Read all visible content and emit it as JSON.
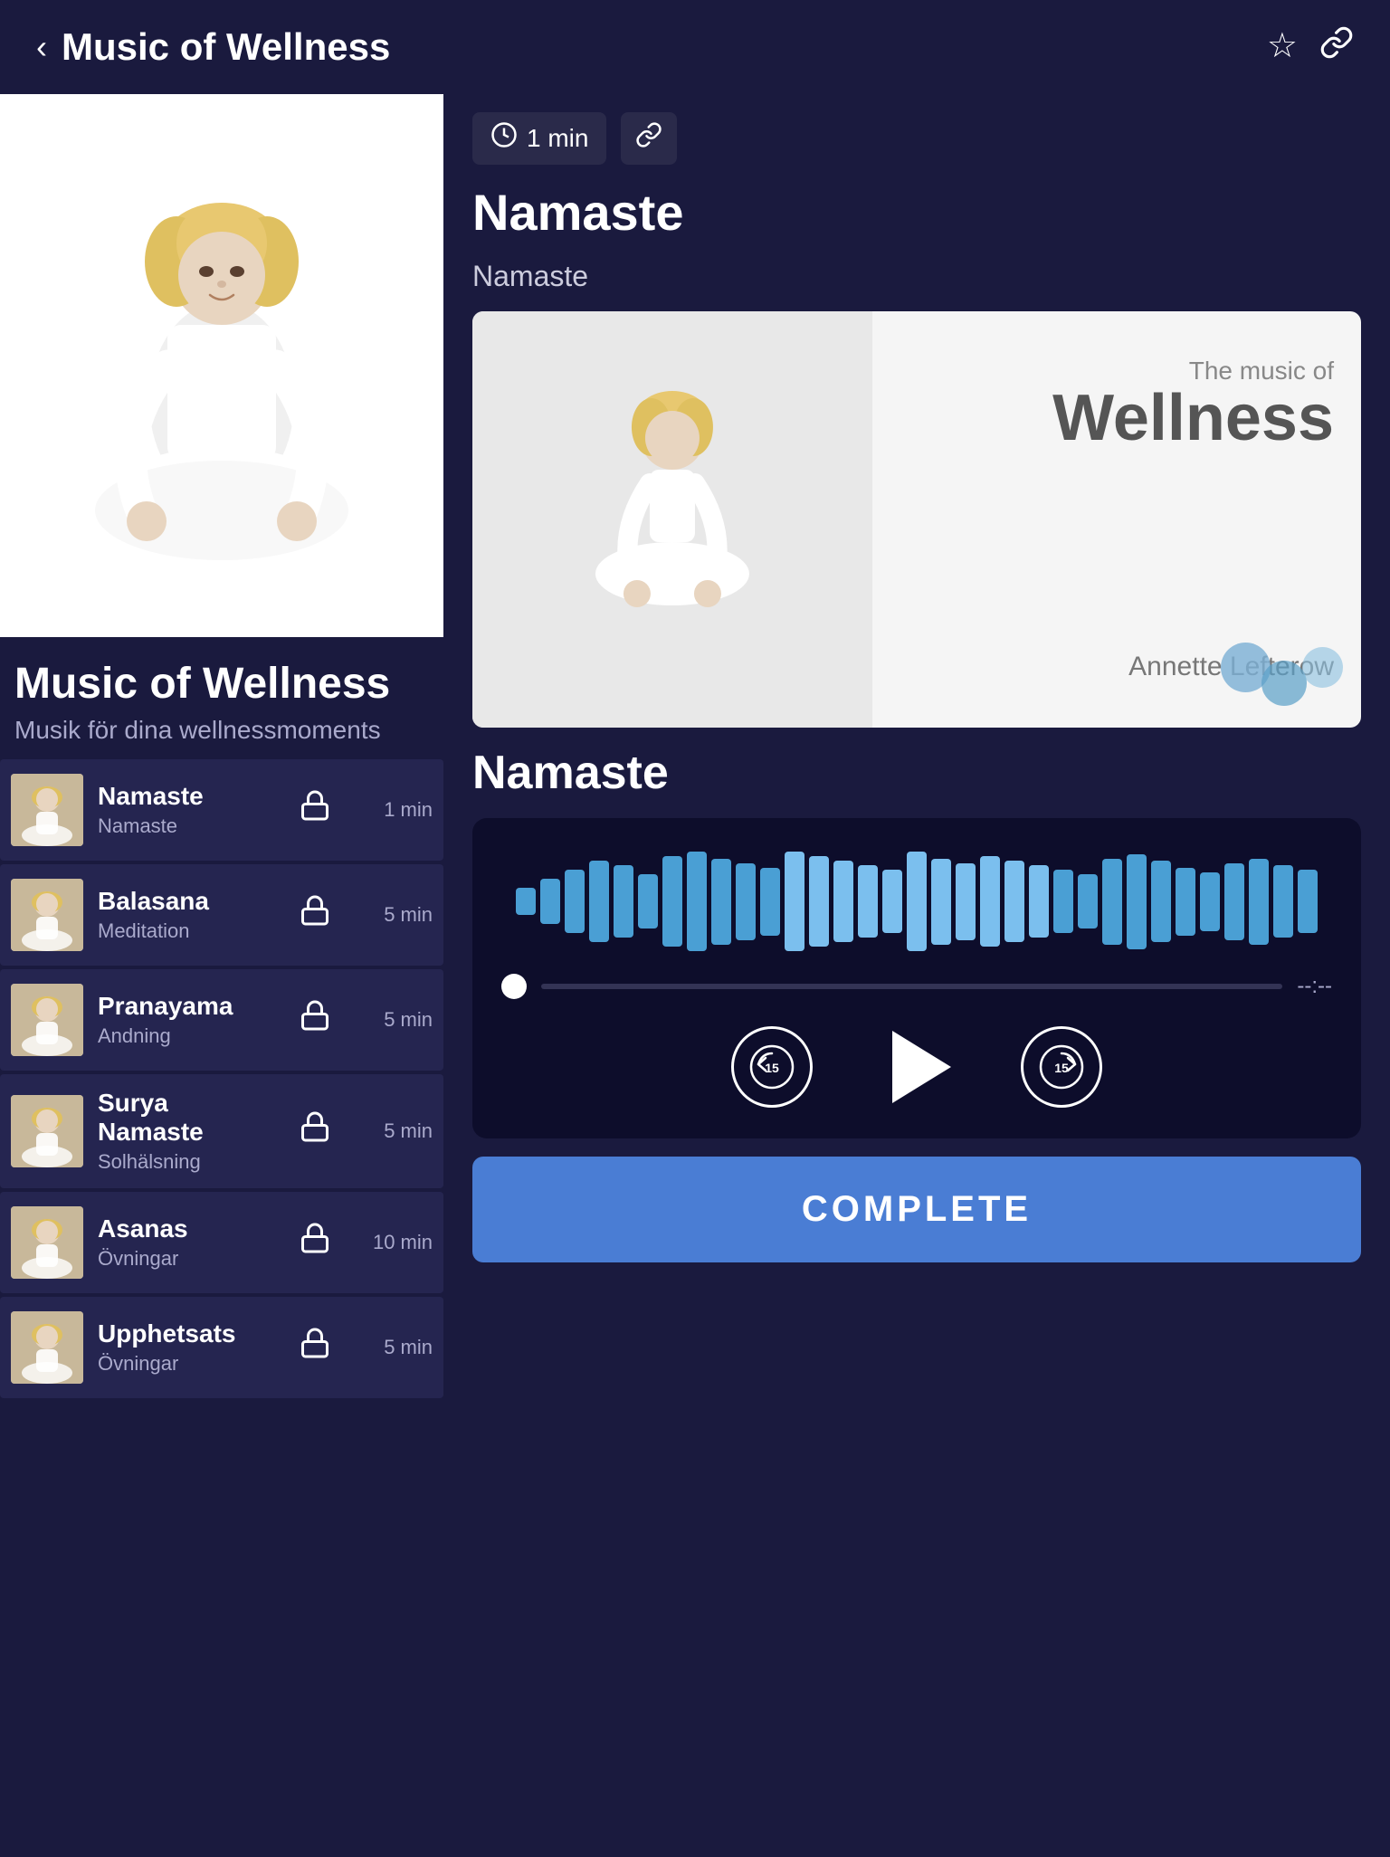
{
  "header": {
    "title": "Music of Wellness",
    "back_label": "‹",
    "star_icon": "☆",
    "link_icon": "🔗"
  },
  "album": {
    "title": "Music of Wellness",
    "subtitle": "Musik för dina wellnessmoments"
  },
  "detail": {
    "duration": "1 min",
    "track_name": "Namaste",
    "track_subtitle": "Namaste",
    "player_track_name": "Namaste",
    "album_card": {
      "subtitle": "The music of",
      "title": "Wellness",
      "artist": "Annette Lefterow"
    },
    "progress_time": "--:--",
    "complete_label": "COMPLETE"
  },
  "tracks": [
    {
      "name": "Namaste",
      "desc": "Namaste",
      "duration": "1 min",
      "locked": true
    },
    {
      "name": "Balasana",
      "desc": "Meditation",
      "duration": "5 min",
      "locked": true
    },
    {
      "name": "Pranayama",
      "desc": "Andning",
      "duration": "5 min",
      "locked": true
    },
    {
      "name": "Surya Namaste",
      "desc": "Solhälsning",
      "duration": "5 min",
      "locked": true
    },
    {
      "name": "Asanas",
      "desc": "Övningar",
      "duration": "10 min",
      "locked": true
    },
    {
      "name": "Upphetsats",
      "desc": "Övningar",
      "duration": "5 min",
      "locked": true
    }
  ],
  "controls": {
    "rewind_label": "15",
    "forward_label": "15"
  }
}
